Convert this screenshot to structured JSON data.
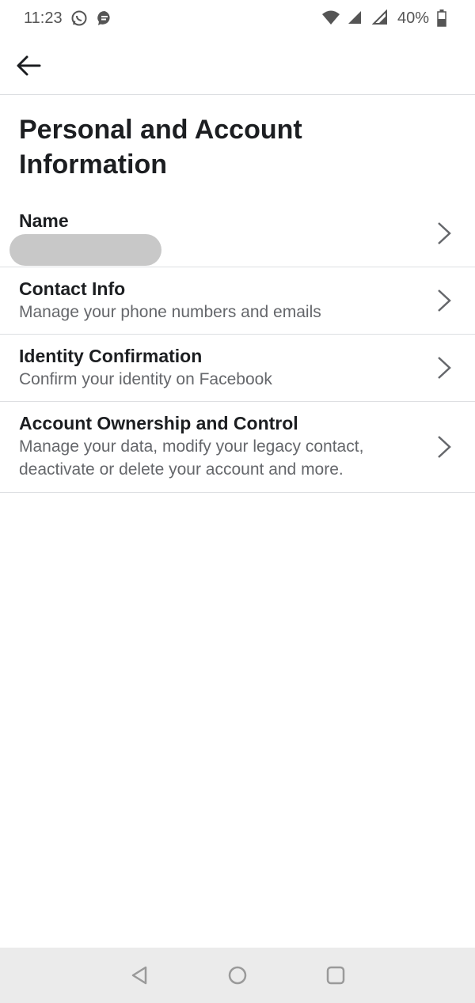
{
  "status_bar": {
    "time": "11:23",
    "battery": "40%",
    "icons": [
      "whatsapp-icon",
      "messenger-icon",
      "wifi-icon",
      "signal-icon",
      "signal-icon",
      "battery-icon"
    ]
  },
  "header": {
    "back_icon": "back-arrow-icon"
  },
  "page": {
    "title": "Personal and Account Information"
  },
  "items": [
    {
      "title": "Name",
      "subtitle": ""
    },
    {
      "title": "Contact Info",
      "subtitle": "Manage your phone numbers and emails"
    },
    {
      "title": "Identity Confirmation",
      "subtitle": "Confirm your identity on Facebook"
    },
    {
      "title": "Account Ownership and Control",
      "subtitle": "Manage your data, modify your legacy contact, deactivate or delete your account and more."
    }
  ],
  "nav": {
    "icons": [
      "back-triangle-icon",
      "home-circle-icon",
      "recents-square-icon"
    ]
  },
  "colors": {
    "text_primary": "#1c1e21",
    "text_secondary": "#65676b",
    "divider": "#dddfe2",
    "nav_bg": "#ebebeb"
  }
}
